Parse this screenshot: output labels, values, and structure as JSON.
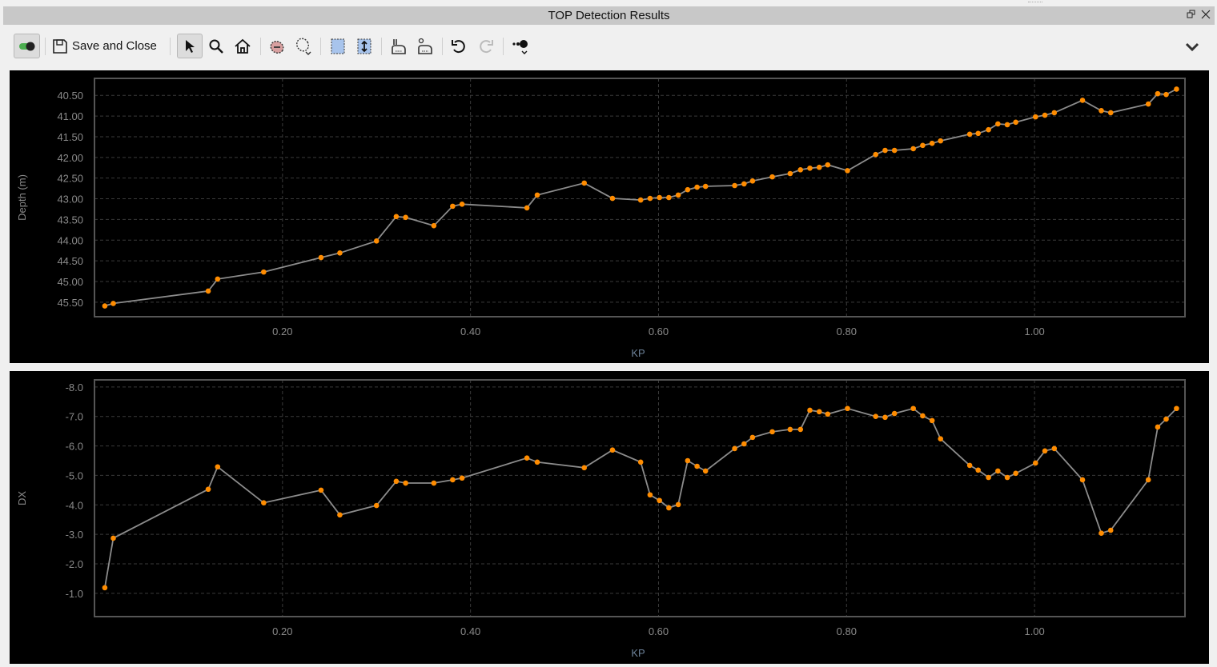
{
  "window": {
    "title": "TOP Detection Results",
    "restore_icon": "restore-icon",
    "close_icon": "close-icon"
  },
  "toolbar": {
    "save_label": "Save and Close",
    "icons": [
      "toggle-icon",
      "save-icon",
      "pointer-icon",
      "zoom-icon",
      "home-icon",
      "erase-selection-icon",
      "lasso-icon",
      "select-range-icon",
      "vertical-range-icon",
      "pick-add-icon",
      "pick-remove-icon",
      "undo-icon",
      "redo-icon",
      "point-style-icon",
      "chevron-down-icon"
    ]
  },
  "colors": {
    "line": "#8c8c8c",
    "marker": "#ff8c00",
    "grid": "#3a3a3a",
    "border": "#555555",
    "tick": "#8a8a8a",
    "xlabel": "#6d8299"
  },
  "chart_data": [
    {
      "type": "line",
      "title": "",
      "xlabel": "KP",
      "ylabel": "Depth (m)",
      "xlim": [
        0,
        1.16
      ],
      "ylim": [
        45.85,
        40.09
      ],
      "y_inverted": true,
      "grid": true,
      "xticks": [
        0.2,
        0.4,
        0.6,
        0.8,
        1.0
      ],
      "xtick_labels": [
        "0.20",
        "0.40",
        "0.60",
        "0.80",
        "1.00"
      ],
      "yticks": [
        40.5,
        41,
        41.5,
        42,
        42.5,
        43,
        43.5,
        44,
        44.5,
        45,
        45.5
      ],
      "ytick_labels": [
        "40.50",
        "41.00",
        "41.50",
        "42.00",
        "42.50",
        "43.00",
        "43.50",
        "44.00",
        "44.50",
        "45.00",
        "45.50"
      ],
      "x": [
        0.011,
        0.02,
        0.121,
        0.131,
        0.18,
        0.241,
        0.261,
        0.3,
        0.321,
        0.331,
        0.361,
        0.381,
        0.391,
        0.46,
        0.471,
        0.521,
        0.551,
        0.581,
        0.591,
        0.601,
        0.611,
        0.621,
        0.631,
        0.641,
        0.65,
        0.681,
        0.691,
        0.7,
        0.721,
        0.74,
        0.751,
        0.761,
        0.771,
        0.78,
        0.801,
        0.831,
        0.841,
        0.851,
        0.871,
        0.881,
        0.891,
        0.9,
        0.931,
        0.94,
        0.951,
        0.961,
        0.971,
        0.98,
        1.001,
        1.011,
        1.021,
        1.051,
        1.071,
        1.081,
        1.121,
        1.131,
        1.14,
        1.151
      ],
      "y": [
        45.59,
        45.53,
        45.23,
        44.94,
        44.77,
        44.42,
        44.31,
        44.02,
        43.43,
        43.45,
        43.65,
        43.18,
        43.13,
        43.22,
        42.91,
        42.62,
        42.99,
        43.03,
        42.99,
        42.97,
        42.97,
        42.91,
        42.78,
        42.72,
        42.7,
        42.68,
        42.64,
        42.57,
        42.47,
        42.39,
        42.3,
        42.26,
        42.24,
        42.18,
        42.32,
        41.93,
        41.83,
        41.83,
        41.79,
        41.71,
        41.66,
        41.6,
        41.44,
        41.42,
        41.33,
        41.19,
        41.21,
        41.15,
        41.02,
        40.98,
        40.92,
        40.62,
        40.87,
        40.92,
        40.71,
        40.46,
        40.48,
        40.35
      ]
    },
    {
      "type": "line",
      "title": "",
      "xlabel": "KP",
      "ylabel": "DX",
      "xlim": [
        0,
        1.16
      ],
      "ylim": [
        -0.21,
        -8.24
      ],
      "y_inverted": true,
      "grid": true,
      "xticks": [
        0.2,
        0.4,
        0.6,
        0.8,
        1.0
      ],
      "xtick_labels": [
        "0.20",
        "0.40",
        "0.60",
        "0.80",
        "1.00"
      ],
      "yticks": [
        -8,
        -7,
        -6,
        -5,
        -4,
        -3,
        -2,
        -1
      ],
      "ytick_labels": [
        "-8.0",
        "-7.0",
        "-6.0",
        "-5.0",
        "-4.0",
        "-3.0",
        "-2.0",
        "-1.0"
      ],
      "x": [
        0.011,
        0.02,
        0.121,
        0.131,
        0.18,
        0.241,
        0.261,
        0.3,
        0.321,
        0.331,
        0.361,
        0.381,
        0.391,
        0.46,
        0.471,
        0.521,
        0.551,
        0.581,
        0.591,
        0.601,
        0.611,
        0.621,
        0.631,
        0.641,
        0.65,
        0.681,
        0.691,
        0.7,
        0.721,
        0.74,
        0.751,
        0.761,
        0.771,
        0.78,
        0.801,
        0.831,
        0.841,
        0.851,
        0.871,
        0.881,
        0.891,
        0.9,
        0.931,
        0.94,
        0.951,
        0.961,
        0.971,
        0.98,
        1.001,
        1.011,
        1.021,
        1.051,
        1.071,
        1.081,
        1.121,
        1.131,
        1.14,
        1.151
      ],
      "y": [
        -1.19,
        -2.87,
        -4.53,
        -5.29,
        -4.07,
        -4.5,
        -3.66,
        -3.98,
        -4.8,
        -4.74,
        -4.74,
        -4.85,
        -4.91,
        -5.59,
        -5.45,
        -5.26,
        -5.86,
        -5.45,
        -4.34,
        -4.15,
        -3.9,
        -4.01,
        -5.5,
        -5.31,
        -5.15,
        -5.91,
        -6.07,
        -6.29,
        -6.48,
        -6.56,
        -6.56,
        -7.21,
        -7.16,
        -7.08,
        -7.27,
        -7.0,
        -6.97,
        -7.1,
        -7.27,
        -7.02,
        -6.86,
        -6.24,
        -5.34,
        -5.18,
        -4.93,
        -5.15,
        -4.93,
        -5.07,
        -5.42,
        -5.83,
        -5.91,
        -4.85,
        -3.04,
        -3.14,
        -4.85,
        -6.64,
        -6.91,
        -7.27
      ]
    }
  ]
}
